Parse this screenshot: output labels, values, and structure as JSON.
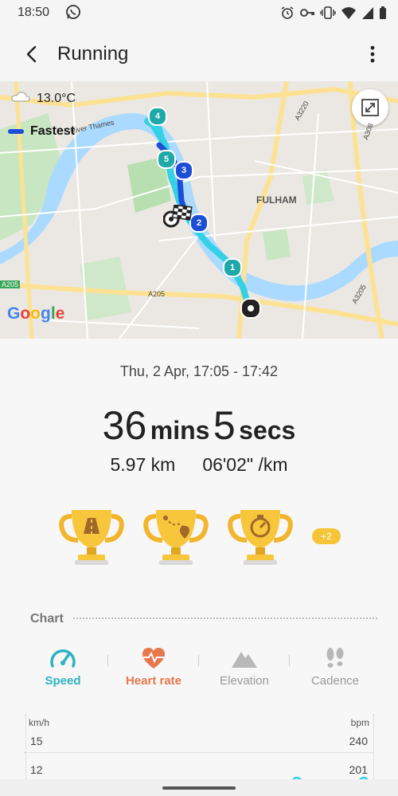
{
  "status_bar": {
    "time": "18:50",
    "icons": [
      "whatsapp-icon",
      "alarm-icon",
      "key-icon",
      "vibrate-icon",
      "wifi-icon",
      "signal-icon",
      "battery-icon"
    ]
  },
  "app_bar": {
    "title": "Running",
    "back_icon": "back-arrow-icon",
    "more_icon": "more-vert-icon"
  },
  "map": {
    "temperature": "13.0°C",
    "legend_label": "Fastest",
    "place_label": "FULHAM",
    "river_label": "River Thames",
    "roads": [
      "A3220",
      "A308",
      "A205",
      "A205",
      "A3205"
    ],
    "attribution": "Google",
    "markers": [
      "1",
      "2",
      "3",
      "4",
      "5"
    ],
    "colors": {
      "route": "#34d0e6",
      "fastest": "#1d4fd6",
      "marker": "#1fa8a8"
    }
  },
  "workout": {
    "date_range": "Thu, 2 Apr, 17:05 - 17:42",
    "duration_mins": "36",
    "mins_label": "mins",
    "duration_secs": "5",
    "secs_label": "secs",
    "distance": "5.97 km",
    "pace": "06'02\" /km",
    "trophies": [
      "road-trophy-icon",
      "route-trophy-icon",
      "stopwatch-trophy-icon"
    ],
    "extra_badge": "+2"
  },
  "chart": {
    "heading": "Chart",
    "tabs": [
      {
        "label": "Speed",
        "icon": "speedometer-icon",
        "color": "#2bb3c0"
      },
      {
        "label": "Heart rate",
        "icon": "heart-rate-icon",
        "color": "#e8774b"
      },
      {
        "label": "Elevation",
        "icon": "mountain-icon",
        "color": "#999999"
      },
      {
        "label": "Cadence",
        "icon": "footprints-icon",
        "color": "#999999"
      }
    ],
    "left_unit": "km/h",
    "right_unit": "bpm",
    "left_ticks": [
      "15",
      "12"
    ],
    "right_ticks": [
      "240",
      "201"
    ]
  }
}
